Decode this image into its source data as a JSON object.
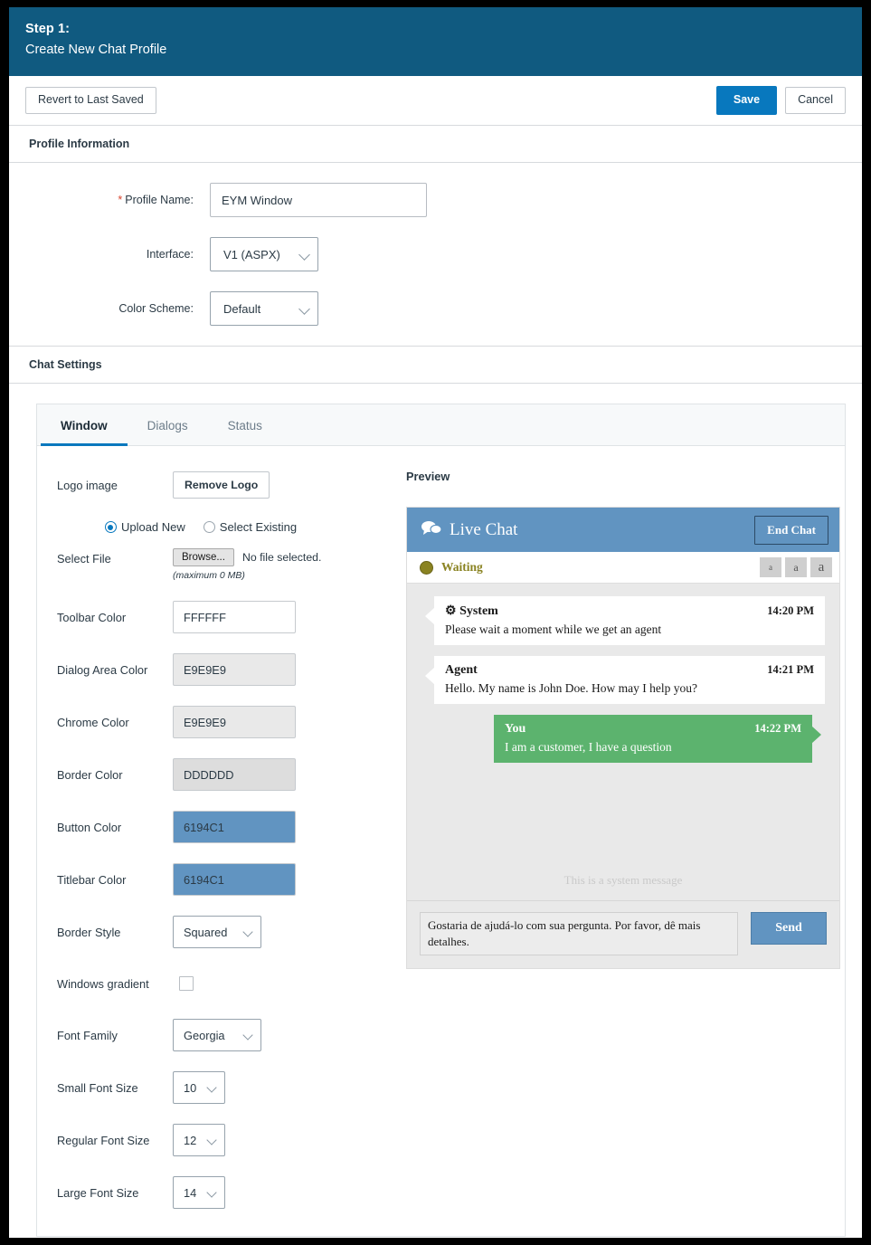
{
  "header": {
    "step": "Step 1:",
    "title": "Create New Chat Profile"
  },
  "actions": {
    "revert_label": "Revert to Last Saved",
    "save_label": "Save",
    "cancel_label": "Cancel"
  },
  "profile_information": {
    "section_title": "Profile Information",
    "profile_name": {
      "label": "Profile Name:",
      "required_mark": "*",
      "value": "EYM Window"
    },
    "interface": {
      "label": "Interface:",
      "value": "V1 (ASPX)"
    },
    "color_scheme": {
      "label": "Color Scheme:",
      "value": "Default"
    }
  },
  "chat_settings": {
    "section_title": "Chat Settings",
    "tabs": [
      {
        "label": "Window",
        "active": true
      },
      {
        "label": "Dialogs",
        "active": false
      },
      {
        "label": "Status",
        "active": false
      }
    ],
    "fields": {
      "logo_image_label": "Logo image",
      "remove_logo_label": "Remove Logo",
      "upload_new_label": "Upload New",
      "select_existing_label": "Select Existing",
      "select_file_label": "Select File",
      "browse_label": "Browse...",
      "no_file_label": "No file selected.",
      "max_note": "(maximum 0 MB)",
      "toolbar_color": {
        "label": "Toolbar Color",
        "value": "FFFFFF"
      },
      "dialog_area_color": {
        "label": "Dialog Area Color",
        "value": "E9E9E9"
      },
      "chrome_color": {
        "label": "Chrome Color",
        "value": "E9E9E9"
      },
      "border_color": {
        "label": "Border Color",
        "value": "DDDDDD"
      },
      "button_color": {
        "label": "Button Color",
        "value": "6194C1"
      },
      "titlebar_color": {
        "label": "Titlebar Color",
        "value": "6194C1"
      },
      "border_style": {
        "label": "Border Style",
        "value": "Squared"
      },
      "windows_gradient": {
        "label": "Windows gradient",
        "checked": false
      },
      "font_family": {
        "label": "Font Family",
        "value": "Georgia"
      },
      "small_font_size": {
        "label": "Small Font Size",
        "value": "10"
      },
      "regular_font_size": {
        "label": "Regular Font Size",
        "value": "12"
      },
      "large_font_size": {
        "label": "Large Font Size",
        "value": "14"
      }
    }
  },
  "preview": {
    "title": "Preview",
    "window_title": "Live Chat",
    "end_chat_label": "End Chat",
    "status_label": "Waiting",
    "font_buttons": [
      "a",
      "a",
      "a"
    ],
    "messages": [
      {
        "from": "System",
        "time": "14:20 PM",
        "text": "Please wait a moment while we get an agent",
        "direction": "in",
        "icon": "gear-icon"
      },
      {
        "from": "Agent",
        "time": "14:21 PM",
        "text": "Hello. My name is John Doe. How may I help you?",
        "direction": "in",
        "icon": ""
      },
      {
        "from": "You",
        "time": "14:22 PM",
        "text": "I am a customer, I have a question",
        "direction": "out",
        "icon": ""
      }
    ],
    "system_message": "This is a system message",
    "input_value": "Gostaria de ajudá-lo com sua pergunta. Por favor, dê mais detalhes.",
    "send_label": "Send"
  },
  "colors": {
    "header_bg": "#105A80",
    "primary_button": "#0878BE",
    "titlebar": "#6194C1",
    "outgoing_bubble": "#5CB36E",
    "status": "#8A8322",
    "dialog_area": "#E9E9E9",
    "border": "#DDDDDD"
  }
}
